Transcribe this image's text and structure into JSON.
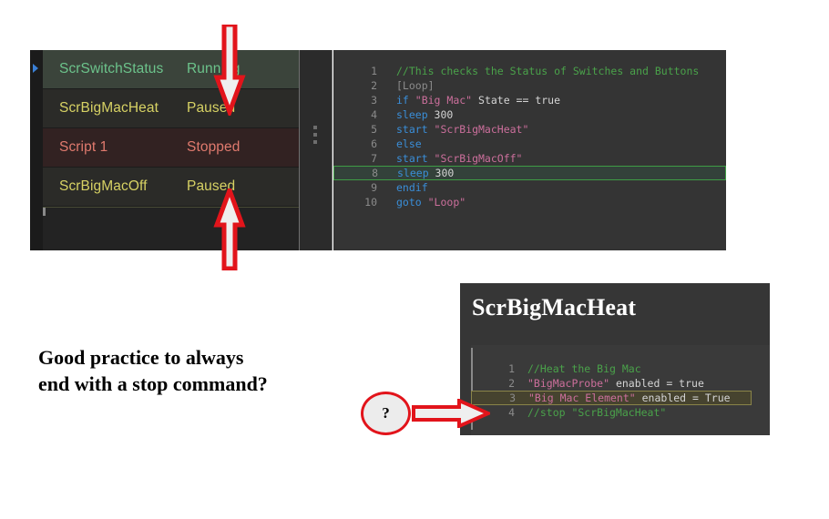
{
  "script_list": {
    "rows": [
      {
        "name": "ScrSwitchStatus",
        "state": "Running",
        "state_kind": "running",
        "selected": true
      },
      {
        "name": "ScrBigMacHeat",
        "state": "Paused",
        "state_kind": "paused",
        "selected": false
      },
      {
        "name": "Script 1",
        "state": "Stopped",
        "state_kind": "stopped",
        "selected": false
      },
      {
        "name": "ScrBigMacOff",
        "state": "Paused",
        "state_kind": "paused",
        "selected": false
      }
    ],
    "colors": {
      "running_text": "#6cc38b",
      "paused_text": "#d7d264",
      "stopped_text": "#e07a6e",
      "running_bg": "#3b443b",
      "paused_bg": "#2b2b28",
      "stopped_bg": "#322222",
      "panel_bg": "#232323"
    },
    "play_indicator_icon": "play-triangle-icon"
  },
  "splitter": {
    "handle_icon": "vertical-dots-grip-icon"
  },
  "code_editor": {
    "background": "#343434",
    "highlight_line": 8,
    "highlight_color": "#3f9c45",
    "lines": [
      {
        "num": "1",
        "segments": [
          {
            "t": "//This checks the Status of Switches and Buttons",
            "c": "comment"
          }
        ]
      },
      {
        "num": "2",
        "segments": [
          {
            "t": "[Loop]",
            "c": "label"
          }
        ]
      },
      {
        "num": "3",
        "segments": [
          {
            "t": "if ",
            "c": "kw"
          },
          {
            "t": "\"Big Mac\"",
            "c": "str"
          },
          {
            "t": " State == true",
            "c": "plain"
          }
        ]
      },
      {
        "num": "4",
        "segments": [
          {
            "t": "sleep ",
            "c": "kw"
          },
          {
            "t": "300",
            "c": "num"
          }
        ]
      },
      {
        "num": "5",
        "segments": [
          {
            "t": "start ",
            "c": "kw"
          },
          {
            "t": "\"ScrBigMacHeat\"",
            "c": "str"
          }
        ]
      },
      {
        "num": "6",
        "segments": [
          {
            "t": "else",
            "c": "kw"
          }
        ]
      },
      {
        "num": "7",
        "segments": [
          {
            "t": "start ",
            "c": "kw"
          },
          {
            "t": "\"ScrBigMacOff\"",
            "c": "str"
          }
        ]
      },
      {
        "num": "8",
        "segments": [
          {
            "t": "sleep ",
            "c": "kw"
          },
          {
            "t": "300",
            "c": "num"
          }
        ],
        "highlight": "green"
      },
      {
        "num": "9",
        "segments": [
          {
            "t": "endif",
            "c": "kw"
          }
        ]
      },
      {
        "num": "10",
        "segments": [
          {
            "t": "goto ",
            "c": "kw"
          },
          {
            "t": "\"Loop\"",
            "c": "str"
          }
        ]
      }
    ]
  },
  "heat_panel": {
    "title": "ScrBigMacHeat",
    "background": "#363636",
    "highlight_line": 3,
    "highlight_color": "#8a8449",
    "lines": [
      {
        "num": "1",
        "segments": [
          {
            "t": "//Heat the Big Mac",
            "c": "comment"
          }
        ]
      },
      {
        "num": "2",
        "segments": [
          {
            "t": "\"BigMacProbe\"",
            "c": "str"
          },
          {
            "t": " enabled = true",
            "c": "plain"
          }
        ]
      },
      {
        "num": "3",
        "segments": [
          {
            "t": "\"Big Mac Element\"",
            "c": "str"
          },
          {
            "t": " enabled = True",
            "c": "plain"
          }
        ],
        "highlight": "olive"
      },
      {
        "num": "4",
        "segments": [
          {
            "t": "//stop \"ScrBigMacHeat\"",
            "c": "comment"
          }
        ]
      }
    ]
  },
  "annotations": {
    "arrow_color": "#e2141b",
    "arrow_fill": "#efefef",
    "arrow_down_top": {
      "icon": "arrow-down-icon",
      "points_at": "Running status"
    },
    "arrow_up_bottom": {
      "icon": "arrow-up-icon",
      "points_at": "Paused status"
    },
    "arrow_right": {
      "icon": "arrow-right-icon",
      "points_at": "stop command line"
    },
    "question_badge": "?",
    "caption_line1": "Good practice to always",
    "caption_line2": "end with a stop command?"
  }
}
